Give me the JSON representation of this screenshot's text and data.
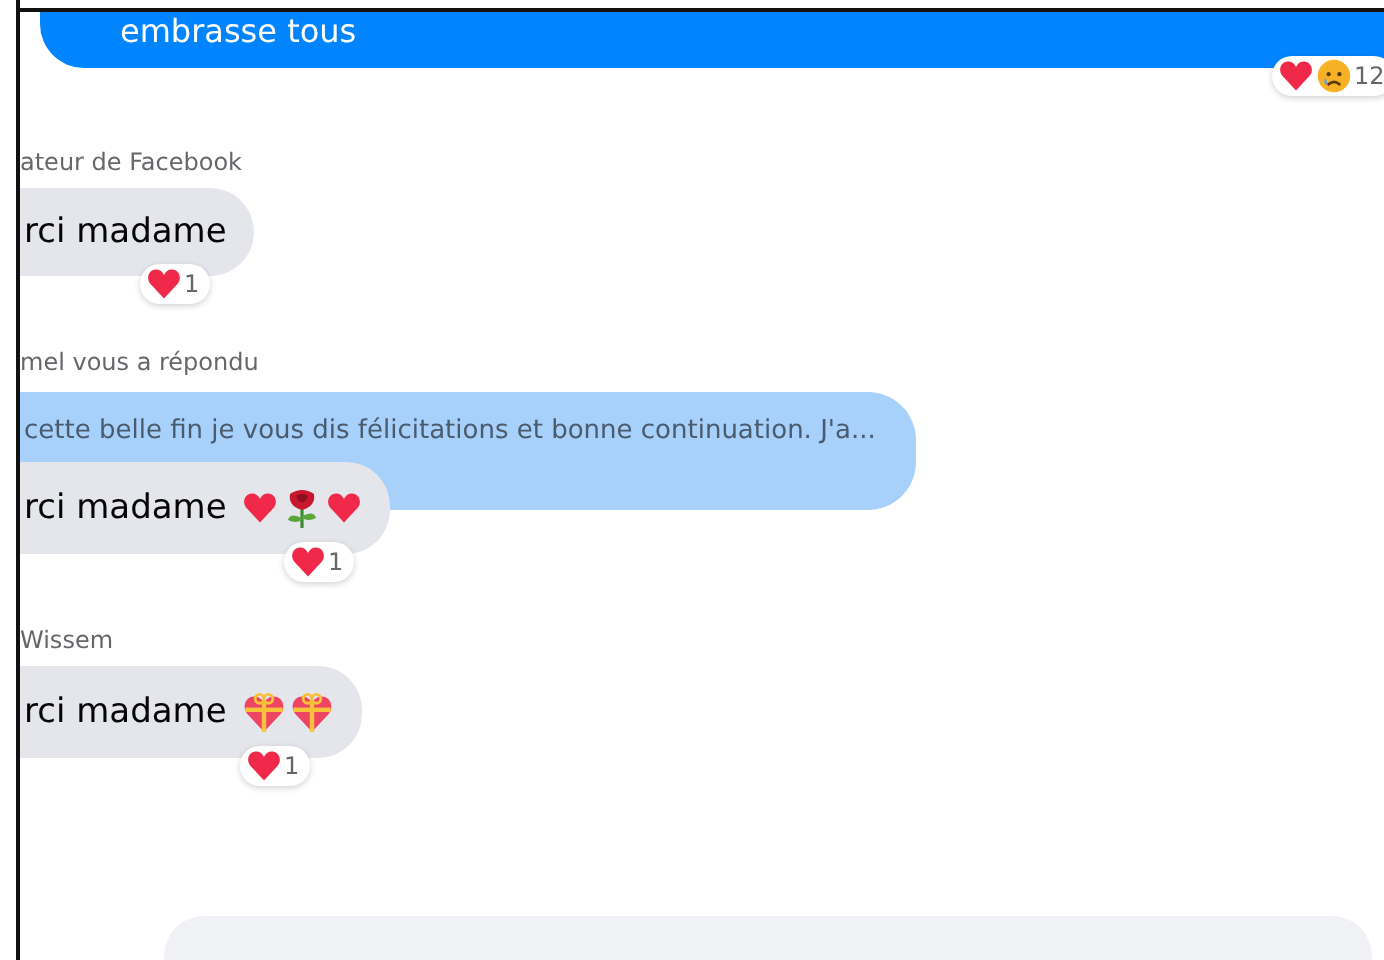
{
  "top_message": {
    "text": "embrasse tous",
    "reactions": [
      {
        "kind": "heart"
      },
      {
        "kind": "sad"
      }
    ],
    "count": "12"
  },
  "messages": [
    {
      "sender": "ateur de Facebook",
      "text": "rci madame",
      "reactions": [
        {
          "kind": "heart"
        }
      ],
      "count": "1"
    },
    {
      "sender": "mel vous a répondu",
      "reply_to": "cette belle fin je vous dis félicitations et bonne continuation. J'a...",
      "text": "rci madame",
      "emojis": [
        {
          "kind": "heart"
        },
        {
          "kind": "rose"
        },
        {
          "kind": "heart"
        }
      ],
      "reactions": [
        {
          "kind": "heart"
        }
      ],
      "count": "1"
    },
    {
      "sender": "Wissem",
      "text": "rci madame",
      "emojis": [
        {
          "kind": "gift_heart"
        },
        {
          "kind": "gift_heart"
        }
      ],
      "reactions": [
        {
          "kind": "heart"
        }
      ],
      "count": "1"
    }
  ]
}
